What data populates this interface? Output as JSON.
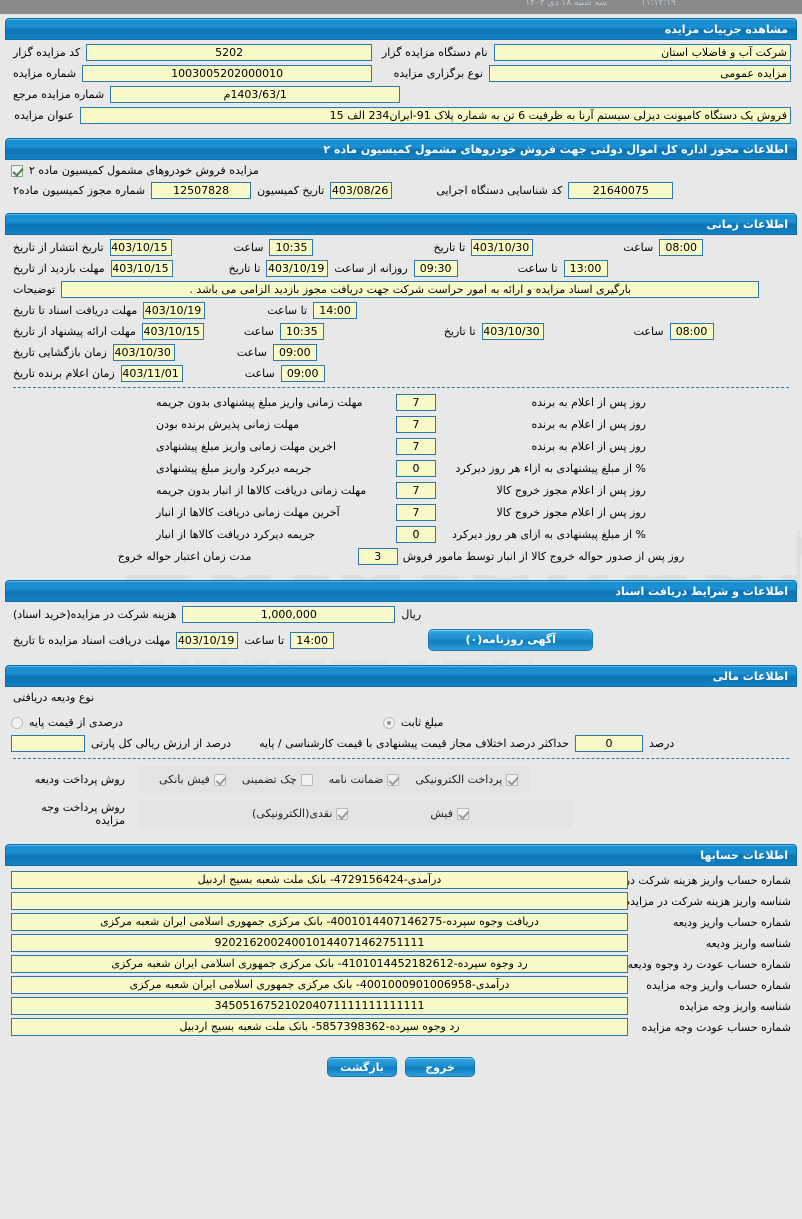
{
  "statusbar": {
    "time": "۱۱:۱۲:۱۹",
    "date": "سه شنبه ۱۸ دی ۱۴۰۳"
  },
  "sections": {
    "details": {
      "title": "مشاهده جزییات مزایده",
      "auctioneer_code_label": "کد مزایده گزار",
      "auctioneer_code_value": "5202",
      "auctioneer_name_label": "نام دستگاه مزایده گزار",
      "auctioneer_name_value": "شرکت آب و فاضلاب استان",
      "auction_number_label": "شماره مزایده",
      "auction_number_value": "1003005202000010",
      "auction_type_label": "نوع برگزاری مزایده",
      "auction_type_value": "مزایده عمومی",
      "ref_number_label": "شماره مزایده مرجع",
      "ref_number_value": "1403/63/1م",
      "subject_label": "عنوان مزایده",
      "subject_value": "فروش یک دستگاه کامیونت دیزلی سیستم آرنا به ظرفیت 6 تن به شماره پلاک 91-ایران234 الف 15"
    },
    "permit": {
      "title": "اطلاعات مجوز اداره کل اموال دولتی جهت فروش خودروهای مشمول کمیسیون ماده ۲",
      "checkbox_label": "مزایده فروش خودروهای مشمول کمیسیون ماده ۲",
      "checkbox_checked": true,
      "permit_number_label": "شماره مجوز کمیسیون ماده۲",
      "permit_number_value": "12507828",
      "commission_date_label": "تاریخ کمیسیون",
      "commission_date_value": "1403/08/26",
      "agency_code_label": "کد شناسایی دستگاه اجرایی",
      "agency_code_value": "21640075"
    },
    "timing": {
      "title": "اطلاعات زمانی",
      "rows": [
        {
          "label": "تاریخ انتشار  از تاریخ",
          "date_from": "1403/10/15",
          "time_label": "ساعت",
          "time_from": "10:35",
          "to_label": "تا تاریخ",
          "date_to": "1403/10/30",
          "to_time_label": "ساعت",
          "time_to": "08:00"
        },
        {
          "label": "مهلت بازدید  از تاریخ",
          "date_from": "1403/10/15",
          "to_label": "تا تاریخ",
          "date_to": "1403/10/19",
          "time_label": "روزانه از ساعت",
          "time_from": "09:30",
          "to_time_label": "تا ساعت",
          "time_to": "13:00"
        }
      ],
      "desc_label": "توضیحات",
      "desc_value": "بارگیری اسناد مزایده و ارائه به امور حراست شرکت جهت دریافت مجوز بازدید الزامی می باشد .",
      "docs_label": "مهلت دریافت اسناد  تا تاریخ",
      "docs_date": "1403/10/19",
      "docs_time_label": "تا ساعت",
      "docs_time": "14:00",
      "offer_label": "مهلت ارائه پیشنهاد  از تاریخ",
      "offer_date_from": "1403/10/15",
      "offer_time_label": "ساعت",
      "offer_time_from": "10:35",
      "offer_to_label": "تا تاریخ",
      "offer_date_to": "1403/10/30",
      "offer_to_time_label": "ساعت",
      "offer_time_to": "08:00",
      "open_label": "زمان بازگشایی    تاریخ",
      "open_date": "1403/10/30",
      "open_time_label": "ساعت",
      "open_time": "09:00",
      "winner_label": "زمان اعلام برنده   تاریخ",
      "winner_date": "1403/11/01",
      "winner_time_label": "ساعت",
      "winner_time": "09:00"
    },
    "deadlines": {
      "items": [
        {
          "label": "مهلت زمانی واریز مبلغ پیشنهادی بدون جریمه",
          "value": "7",
          "suffix": "روز پس از اعلام به برنده"
        },
        {
          "label": "مهلت زمانی پذیرش برنده بودن",
          "value": "7",
          "suffix": "روز پس از اعلام به برنده"
        },
        {
          "label": "اخرین مهلت زمانی واریز مبلغ پیشنهادی",
          "value": "7",
          "suffix": "روز پس از اعلام به برنده"
        },
        {
          "label": "جریمه دیرکرد واریز مبلغ پیشنهادی",
          "value": "0",
          "suffix": "% از مبلغ پیشنهادی به ازاء هر روز دیرکرد"
        },
        {
          "label": "مهلت زمانی دریافت کالاها از انبار بدون جریمه",
          "value": "7",
          "suffix": "روز پس از اعلام مجوز خروج کالا"
        },
        {
          "label": "آخرین مهلت زمانی دریافت کالاها از انبار",
          "value": "7",
          "suffix": "روز پس از اعلام مجوز خروج کالا"
        },
        {
          "label": "جریمه دیرکرد دریافت کالاها از انبار",
          "value": "0",
          "suffix": "% از مبلغ پیشنهادی به ازای هر روز دیرکرد"
        },
        {
          "label": "مدت زمان اعتبار حواله خروج",
          "value": "3",
          "suffix": "روز پس از صدور حواله خروج کالا از انبار توسط مامور فروش"
        }
      ]
    },
    "documents": {
      "title": "اطلاعات و شرایط دریافت اسناد",
      "fee_label": "هزینه شرکت در مزایده(خرید اسناد)",
      "fee_value": "1,000,000",
      "fee_unit": "ریال",
      "deadline_label": "مهلت دریافت اسناد مزایده تا تاریخ",
      "deadline_date": "1403/10/19",
      "deadline_time_label": "تا ساعت",
      "deadline_time": "14:00",
      "newspaper_button": "آگهی روزنامه(۰)"
    },
    "financial": {
      "title": "اطلاعات مالی",
      "deposit_type_label": "نوع ودیعه دریافتی",
      "percent_option_label": "درصدی از قیمت پایه",
      "percent_option_selected": false,
      "fixed_option_label": "مبلغ ثابت",
      "fixed_option_selected": true,
      "percent_field_label": "درصد از ارزش ریالی کل پارتی",
      "percent_field_value": "",
      "max_diff_label": "حداکثر درصد اختلاف مجاز قیمت پیشنهادی با قیمت کارشناسی / پایه",
      "max_diff_value": "0",
      "max_diff_unit": "درصد",
      "deposit_method_label": "روش پرداخت ودیعه",
      "deposit_methods": [
        {
          "label": "پرداخت الکترونیکی",
          "checked": true
        },
        {
          "label": "ضمانت نامه",
          "checked": true
        },
        {
          "label": "چک تضمینی",
          "checked": false
        },
        {
          "label": "فیش بانکی",
          "checked": true
        }
      ],
      "payment_method_label": "روش پرداخت وجه مزایده",
      "payment_methods": [
        {
          "label": "فیش",
          "checked": true
        },
        {
          "label": "نقدی(الکترونیکی)",
          "checked": true
        }
      ]
    },
    "accounts": {
      "title": "اطلاعات حسابها",
      "rows": [
        {
          "label": "شماره حساب واریز هزینه شرکت در مزایده",
          "value": "درآمدی-4729156424- بانک ملت شعبه بسیج اردبیل"
        },
        {
          "label": "شناسه واریز هزینه شرکت در مزایده",
          "value": ""
        },
        {
          "label": "شماره حساب واریز ودیعه",
          "value": "دریافت وجوه سپرده-4001014407146275- بانک مرکزی جمهوری اسلامی ایران شعبه مرکزی"
        },
        {
          "label": "شناسه واریز ودیعه",
          "value": "920216200240010144071462751111"
        },
        {
          "label": "شماره حساب عودت رد وجوه ودیعه",
          "value": "رد وجوه سپرده-4101014452182612- بانک مرکزی جمهوری اسلامی ایران شعبه مرکزی"
        },
        {
          "label": "شماره حساب واریز وجه مزایده",
          "value": "درآمدی-4001000901006958- بانک مرکزی جمهوری اسلامی ایران شعبه مرکزی"
        },
        {
          "label": "شناسه واریز وجه مزایده",
          "value": "345051675210204071111111111111"
        },
        {
          "label": "شماره حساب عودت وجه مزایده",
          "value": "رد وجوه سپرده-5857398362- بانک ملت شعبه بسیج اردبیل"
        }
      ]
    }
  },
  "footer": {
    "back_button": "بازگشت",
    "exit_button": "خروج"
  },
  "watermark": {
    "brand": "Datatender",
    "line1": "رنجیره معاملاتی آریاتندر",
    "line2": ""
  },
  "colors": {
    "header_blue": "#1b90d2",
    "field_yellow": "#fafac8",
    "field_border": "#2a7ab0",
    "page_bg": "#e8e8e8"
  }
}
